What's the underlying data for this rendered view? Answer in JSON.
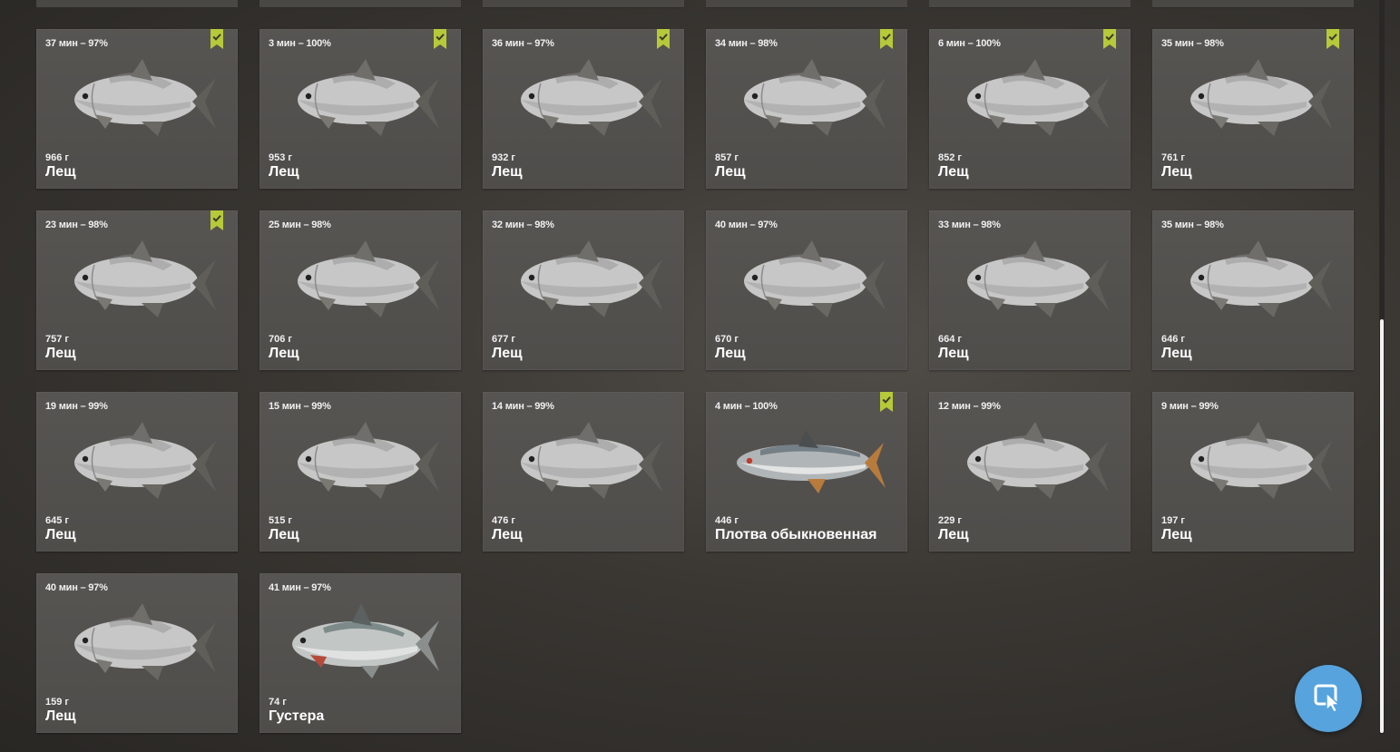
{
  "cards": [
    {
      "time": "37 мин – 97%",
      "weight": "966 г",
      "name": "Лещ",
      "fish": "bream",
      "badge": true
    },
    {
      "time": "3 мин – 100%",
      "weight": "953 г",
      "name": "Лещ",
      "fish": "bream",
      "badge": true
    },
    {
      "time": "36 мин – 97%",
      "weight": "932 г",
      "name": "Лещ",
      "fish": "bream",
      "badge": true
    },
    {
      "time": "34 мин – 98%",
      "weight": "857 г",
      "name": "Лещ",
      "fish": "bream",
      "badge": true
    },
    {
      "time": "6 мин – 100%",
      "weight": "852 г",
      "name": "Лещ",
      "fish": "bream",
      "badge": true
    },
    {
      "time": "35 мин – 98%",
      "weight": "761 г",
      "name": "Лещ",
      "fish": "bream",
      "badge": true
    },
    {
      "time": "23 мин – 98%",
      "weight": "757 г",
      "name": "Лещ",
      "fish": "bream",
      "badge": true
    },
    {
      "time": "25 мин – 98%",
      "weight": "706 г",
      "name": "Лещ",
      "fish": "bream",
      "badge": false
    },
    {
      "time": "32 мин – 98%",
      "weight": "677 г",
      "name": "Лещ",
      "fish": "bream",
      "badge": false
    },
    {
      "time": "40 мин – 97%",
      "weight": "670 г",
      "name": "Лещ",
      "fish": "bream",
      "badge": false
    },
    {
      "time": "33 мин – 98%",
      "weight": "664 г",
      "name": "Лещ",
      "fish": "bream",
      "badge": false
    },
    {
      "time": "35 мин – 98%",
      "weight": "646 г",
      "name": "Лещ",
      "fish": "bream",
      "badge": false
    },
    {
      "time": "19 мин – 99%",
      "weight": "645 г",
      "name": "Лещ",
      "fish": "bream",
      "badge": false
    },
    {
      "time": "15 мин – 99%",
      "weight": "515 г",
      "name": "Лещ",
      "fish": "bream",
      "badge": false
    },
    {
      "time": "14 мин – 99%",
      "weight": "476 г",
      "name": "Лещ",
      "fish": "bream",
      "badge": false
    },
    {
      "time": "4 мин – 100%",
      "weight": "446 г",
      "name": "Плотва обыкновенная",
      "fish": "roach",
      "badge": true
    },
    {
      "time": "12 мин – 99%",
      "weight": "229 г",
      "name": "Лещ",
      "fish": "bream",
      "badge": false
    },
    {
      "time": "9 мин – 99%",
      "weight": "197 г",
      "name": "Лещ",
      "fish": "bream",
      "badge": false
    },
    {
      "time": "40 мин – 97%",
      "weight": "159 г",
      "name": "Лещ",
      "fish": "bream",
      "badge": false
    },
    {
      "time": "41 мин – 97%",
      "weight": "74 г",
      "name": "Густера",
      "fish": "silver-bream",
      "badge": false
    }
  ],
  "colors": {
    "badge": "#b5c93a",
    "cursor_button": "#56a3dd",
    "card": "#535150",
    "scrollbar_thumb": "#f2f2f2"
  },
  "icons": {
    "badge": "checkmark-bookmark-icon",
    "cursor_button": "cursor-click-icon"
  }
}
